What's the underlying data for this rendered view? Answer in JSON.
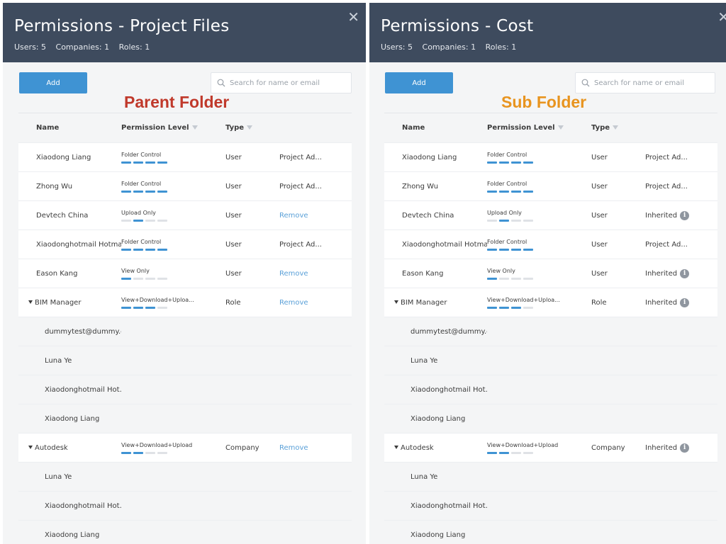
{
  "left": {
    "title": "Permissions - Project Files",
    "stats": [
      "Users: 5",
      "Companies: 1",
      "Roles: 1"
    ],
    "add_label": "Add",
    "search_placeholder": "Search for name or email",
    "folder_label": "Parent Folder",
    "folder_label_color": "#c0392b",
    "columns": [
      "Name",
      "Permission Level",
      "Type"
    ],
    "rows": [
      {
        "kind": "user",
        "name": "Xiaodong Liang",
        "perm": "Folder Control",
        "level": 4,
        "type": "User",
        "extra": "Project Ad..."
      },
      {
        "kind": "user",
        "name": "Zhong Wu",
        "perm": "Folder Control",
        "level": 4,
        "type": "User",
        "extra": "Project Ad..."
      },
      {
        "kind": "user",
        "name": "Devtech China",
        "perm": "Upload Only",
        "level": -2,
        "type": "User",
        "extra": "Remove",
        "extra_link": true
      },
      {
        "kind": "user",
        "name": "Xiaodonghotmail Hotmail",
        "perm": "Folder Control",
        "level": 4,
        "type": "User",
        "extra": "Project Ad..."
      },
      {
        "kind": "user",
        "name": "Eason Kang",
        "perm": "View Only",
        "level": 1,
        "type": "User",
        "extra": "Remove",
        "extra_link": true
      },
      {
        "kind": "group",
        "name": "BIM Manager",
        "perm": "View+Download+Uploa...",
        "level": 3,
        "type": "Role",
        "extra": "Remove",
        "extra_link": true
      },
      {
        "kind": "sub",
        "name": "dummytest@dummy.c..."
      },
      {
        "kind": "sub",
        "name": "Luna Ye"
      },
      {
        "kind": "sub",
        "name": "Xiaodonghotmail Hot..."
      },
      {
        "kind": "sub",
        "name": "Xiaodong Liang"
      },
      {
        "kind": "group",
        "name": "Autodesk",
        "perm": "View+Download+Upload",
        "level": 2,
        "type": "Company",
        "extra": "Remove",
        "extra_link": true
      },
      {
        "kind": "sub",
        "name": "Luna Ye"
      },
      {
        "kind": "sub",
        "name": "Xiaodonghotmail Hot..."
      },
      {
        "kind": "sub",
        "name": "Xiaodong Liang"
      }
    ]
  },
  "right": {
    "title": "Permissions - Cost",
    "stats": [
      "Users: 5",
      "Companies: 1",
      "Roles: 1"
    ],
    "add_label": "Add",
    "search_placeholder": "Search for name or email",
    "folder_label": "Sub Folder",
    "folder_label_color": "#e8941f",
    "columns": [
      "Name",
      "Permission Level",
      "Type"
    ],
    "rows": [
      {
        "kind": "user",
        "name": "Xiaodong Liang",
        "perm": "Folder Control",
        "level": 4,
        "type": "User",
        "extra": "Project Ad..."
      },
      {
        "kind": "user",
        "name": "Zhong Wu",
        "perm": "Folder Control",
        "level": 4,
        "type": "User",
        "extra": "Project Ad..."
      },
      {
        "kind": "user",
        "name": "Devtech China",
        "perm": "Upload Only",
        "level": -2,
        "type": "User",
        "extra": "Inherited",
        "extra_info": true
      },
      {
        "kind": "user",
        "name": "Xiaodonghotmail Hotmail",
        "perm": "Folder Control",
        "level": 4,
        "type": "User",
        "extra": "Project Ad..."
      },
      {
        "kind": "user",
        "name": "Eason Kang",
        "perm": "View Only",
        "level": 1,
        "type": "User",
        "extra": "Inherited",
        "extra_info": true
      },
      {
        "kind": "group",
        "name": "BIM Manager",
        "perm": "View+Download+Uploa...",
        "level": 3,
        "type": "Role",
        "extra": "Inherited",
        "extra_info": true
      },
      {
        "kind": "sub",
        "name": "dummytest@dummy.c..."
      },
      {
        "kind": "sub",
        "name": "Luna Ye"
      },
      {
        "kind": "sub",
        "name": "Xiaodonghotmail Hot..."
      },
      {
        "kind": "sub",
        "name": "Xiaodong Liang"
      },
      {
        "kind": "group",
        "name": "Autodesk",
        "perm": "View+Download+Upload",
        "level": 2,
        "type": "Company",
        "extra": "Inherited",
        "extra_info": true
      },
      {
        "kind": "sub",
        "name": "Luna Ye"
      },
      {
        "kind": "sub",
        "name": "Xiaodonghotmail Hot..."
      },
      {
        "kind": "sub",
        "name": "Xiaodong Liang"
      }
    ]
  }
}
